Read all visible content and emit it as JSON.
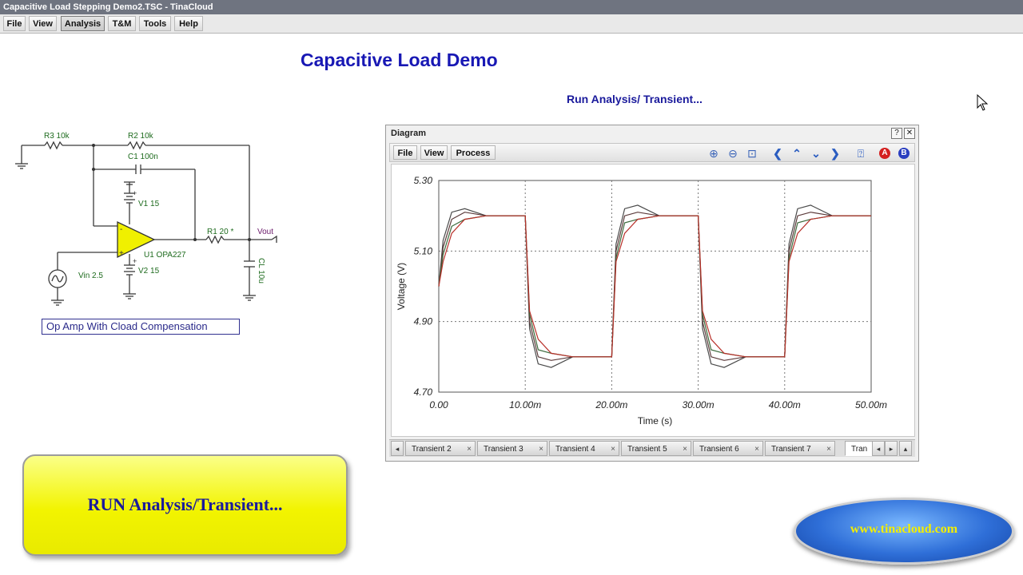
{
  "window": {
    "title": "Capacitive Load Stepping Demo2.TSC - TinaCloud"
  },
  "menu": {
    "items": [
      "File",
      "View",
      "Analysis",
      "T&M",
      "Tools",
      "Help"
    ],
    "active": "Analysis"
  },
  "page": {
    "title": "Capacitive Load Demo",
    "instruction": "Run Analysis/ Transient..."
  },
  "schematic": {
    "caption": "Op Amp With Cload Compensation",
    "labels": {
      "r3": "R3 10k",
      "r2": "R2 10k",
      "c1": "C1 100n",
      "v1": "V1 15",
      "v2": "V2 15",
      "u1": "U1 OPA227",
      "r1": "R1 20 *",
      "vout": "Vout",
      "vin": "Vin 2.5",
      "cl": "CL 10u",
      "plus": "+",
      "minus": "-"
    }
  },
  "diagram": {
    "title": "Diagram",
    "menu": [
      "File",
      "View",
      "Process"
    ],
    "tabs": [
      "Transient 2",
      "Transient 3",
      "Transient 4",
      "Transient 5",
      "Transient 6",
      "Transient 7",
      "Tran"
    ],
    "toolbar_icons": [
      "zoom-in-icon",
      "zoom-out-icon",
      "zoom-fit-icon",
      "arrow-left-icon",
      "arrow-up-icon",
      "arrow-down-icon",
      "arrow-right-icon",
      "help-icon",
      "cursor-a-icon",
      "cursor-b-icon"
    ]
  },
  "chart_data": {
    "type": "line",
    "xlabel": "Time (s)",
    "ylabel": "Voltage (V)",
    "xlim": [
      0,
      0.05
    ],
    "ylim": [
      4.7,
      5.3
    ],
    "xticks": [
      "0.00",
      "10.00m",
      "20.00m",
      "30.00m",
      "40.00m",
      "50.00m"
    ],
    "yticks": [
      "4.70",
      "4.90",
      "5.10",
      "5.30"
    ],
    "grid": true,
    "series": [
      {
        "x": [
          0,
          0.0005,
          0.0015,
          0.003,
          0.0055,
          0.008,
          0.01,
          0.0105,
          0.0115,
          0.013,
          0.0155,
          0.018,
          0.02,
          0.0205,
          0.0215,
          0.023,
          0.0255,
          0.028,
          0.03,
          0.0305,
          0.0315,
          0.033,
          0.0355,
          0.038,
          0.04,
          0.0405,
          0.0415,
          0.043,
          0.0455,
          0.048,
          0.05
        ],
        "y": [
          5.0,
          5.13,
          5.21,
          5.22,
          5.2,
          5.2,
          5.2,
          4.88,
          4.78,
          4.77,
          4.8,
          4.8,
          4.8,
          5.12,
          5.22,
          5.23,
          5.2,
          5.2,
          5.2,
          4.88,
          4.78,
          4.77,
          4.8,
          4.8,
          4.8,
          5.12,
          5.22,
          5.23,
          5.2,
          5.2,
          5.2
        ],
        "color": "#4a4a4a"
      },
      {
        "x": [
          0,
          0.0005,
          0.0015,
          0.003,
          0.0055,
          0.008,
          0.01,
          0.0105,
          0.0115,
          0.013,
          0.0155,
          0.018,
          0.02,
          0.0205,
          0.0215,
          0.023,
          0.0255,
          0.028,
          0.03,
          0.0305,
          0.0315,
          0.033,
          0.0355,
          0.038,
          0.04,
          0.0405,
          0.0415,
          0.043,
          0.0455,
          0.048,
          0.05
        ],
        "y": [
          5.0,
          5.11,
          5.19,
          5.21,
          5.2,
          5.2,
          5.2,
          4.9,
          4.8,
          4.79,
          4.8,
          4.8,
          4.8,
          5.1,
          5.2,
          5.21,
          5.2,
          5.2,
          5.2,
          4.9,
          4.8,
          4.79,
          4.8,
          4.8,
          4.8,
          5.1,
          5.2,
          5.21,
          5.2,
          5.2,
          5.2
        ],
        "color": "#5b3a3a"
      },
      {
        "x": [
          0,
          0.0005,
          0.0015,
          0.003,
          0.0055,
          0.008,
          0.01,
          0.0105,
          0.0115,
          0.013,
          0.0155,
          0.018,
          0.02,
          0.0205,
          0.0215,
          0.023,
          0.0255,
          0.028,
          0.03,
          0.0305,
          0.0315,
          0.033,
          0.0355,
          0.038,
          0.04,
          0.0405,
          0.0415,
          0.043,
          0.0455,
          0.048,
          0.05
        ],
        "y": [
          5.0,
          5.09,
          5.17,
          5.19,
          5.2,
          5.2,
          5.2,
          4.92,
          4.82,
          4.81,
          4.8,
          4.8,
          4.8,
          5.08,
          5.18,
          5.19,
          5.2,
          5.2,
          5.2,
          4.92,
          4.82,
          4.81,
          4.8,
          4.8,
          4.8,
          5.08,
          5.18,
          5.19,
          5.2,
          5.2,
          5.2
        ],
        "color": "#3c6a3c"
      },
      {
        "x": [
          0,
          0.0005,
          0.0015,
          0.003,
          0.0055,
          0.008,
          0.01,
          0.0105,
          0.0115,
          0.013,
          0.0155,
          0.018,
          0.02,
          0.0205,
          0.0215,
          0.023,
          0.0255,
          0.028,
          0.03,
          0.0305,
          0.0315,
          0.033,
          0.0355,
          0.038,
          0.04,
          0.0405,
          0.0415,
          0.043,
          0.0455,
          0.048,
          0.05
        ],
        "y": [
          5.0,
          5.07,
          5.15,
          5.19,
          5.2,
          5.2,
          5.2,
          4.93,
          4.85,
          4.81,
          4.8,
          4.8,
          4.8,
          5.07,
          5.15,
          5.19,
          5.2,
          5.2,
          5.2,
          4.93,
          4.85,
          4.81,
          4.8,
          4.8,
          4.8,
          5.07,
          5.15,
          5.19,
          5.2,
          5.2,
          5.2
        ],
        "color": "#b8302a"
      }
    ]
  },
  "promo": {
    "run_button_label": "RUN Analysis/Transient...",
    "url": "www.tinacloud.com"
  }
}
